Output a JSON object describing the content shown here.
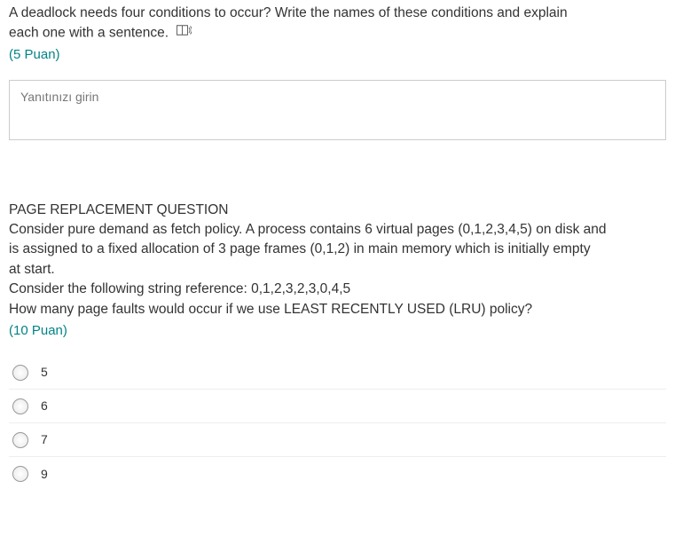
{
  "question1": {
    "text_line1": "A deadlock needs four conditions to occur? Write the names of these conditions and explain",
    "text_line2": "each one with a sentence.",
    "points": "(5 Puan)",
    "answer_placeholder": "Yanıtınızı girin"
  },
  "question2": {
    "title": "PAGE REPLACEMENT QUESTION",
    "body_line1": "Consider pure demand as fetch policy. A process contains 6 virtual pages (0,1,2,3,4,5) on disk and",
    "body_line2": "is assigned to a fixed allocation of 3 page frames (0,1,2) in main memory which is initially empty",
    "body_line3": "at start.",
    "body_line4": "Consider the following string reference: 0,1,2,3,2,3,0,4,5",
    "body_line5": "How many page faults would occur if we use LEAST RECENTLY USED (LRU) policy?",
    "points": "(10 Puan)",
    "options": [
      "5",
      "6",
      "7",
      "9"
    ]
  }
}
